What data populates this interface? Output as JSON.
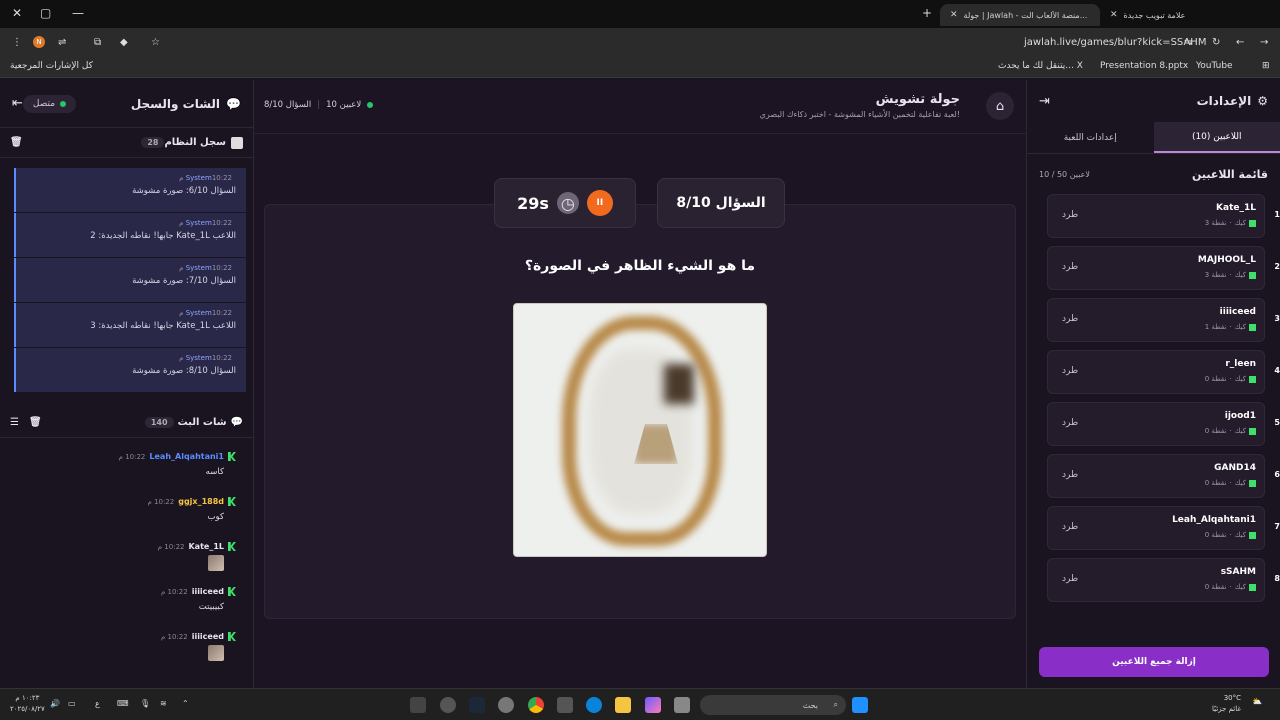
{
  "browser": {
    "tabs": [
      {
        "title": "علامة تبويب جديدة"
      },
      {
        "title": "جولة | Jawlah - منصة الألعاب الت..."
      }
    ],
    "url": "jawlah.live/games/blur?kick=SSAHM",
    "profile_initial": "N",
    "bookmarks": [
      "كل الإشارات المرجعية",
      "يتنقل لك ما يحدث... X",
      "Presentation 8.pptx",
      "YouTube"
    ]
  },
  "left_panel": {
    "title": "الشات والسجل",
    "status": "متصل",
    "system_log": {
      "title": "سجل النظام",
      "count": "28",
      "items": [
        {
          "sender": "System",
          "time": "10:22 م",
          "msg": "السؤال 6/10: صورة مشوشة"
        },
        {
          "sender": "System",
          "time": "10:22 م",
          "msg": "اللاعب Kate_1L جابها! نقاطه الجديدة: 2"
        },
        {
          "sender": "System",
          "time": "10:22 م",
          "msg": "السؤال 7/10: صورة مشوشة"
        },
        {
          "sender": "System",
          "time": "10:22 م",
          "msg": "اللاعب Kate_1L جابها! نقاطه الجديدة: 3"
        },
        {
          "sender": "System",
          "time": "10:22 م",
          "msg": "السؤال 8/10: صورة مشوشة"
        }
      ]
    },
    "stream_chat": {
      "title": "شات البث",
      "count": "140",
      "items": [
        {
          "name": "Leah_Alqahtani1",
          "time": "10:22 م",
          "text": "كاسه",
          "color": "#5b8cff"
        },
        {
          "name": "ggjx_188d",
          "time": "10:22 م",
          "text": "كوب",
          "color": "#f5c542"
        },
        {
          "name": "Kate_1L",
          "time": "10:22 م",
          "text": "",
          "color": "#ffffff"
        },
        {
          "name": "iiiiceed",
          "time": "10:22 م",
          "text": "كبيبيتت",
          "color": "#ffffff"
        },
        {
          "name": "iiiiceed",
          "time": "10:22 م",
          "text": "",
          "color": "#ffffff"
        }
      ]
    }
  },
  "center": {
    "title": "جولة تشويش",
    "subtitle": "لعبة تفاعلية لتخمين الأشياء المشوشة - اختبر ذكاءك البصري!",
    "players_online": "10 لاعبين",
    "question_progress": "السؤال 8/10",
    "question_box": "السؤال 8/10",
    "timer": "29s",
    "pause_symbol": "II",
    "question_text": "ما هو الشيء الظاهر في الصورة؟"
  },
  "right_panel": {
    "title": "الإعدادات",
    "tabs": [
      "اللاعبين (10)",
      "إعدادات اللعبة"
    ],
    "list_title": "قائمة اللاعبين",
    "list_count": "10 / 50 لاعبين",
    "kick_label": "طرد",
    "platform": "كيك",
    "players": [
      {
        "rank": "1",
        "name": "Kate_1L",
        "points": "3 نقطة"
      },
      {
        "rank": "2",
        "name": "MAJHOOL_L",
        "points": "3 نقطة"
      },
      {
        "rank": "3",
        "name": "iiiiceed",
        "points": "1 نقطة"
      },
      {
        "rank": "4",
        "name": "r_leen",
        "points": "0 نقطة"
      },
      {
        "rank": "5",
        "name": "ijood1",
        "points": "0 نقطة"
      },
      {
        "rank": "6",
        "name": "GAND14",
        "points": "0 نقطة"
      },
      {
        "rank": "7",
        "name": "Leah_Alqahtani1",
        "points": "0 نقطة"
      },
      {
        "rank": "8",
        "name": "sSAHM",
        "points": "0 نقطة"
      }
    ],
    "remove_all": "إزالة جميع اللاعبين"
  },
  "taskbar": {
    "search": "بحث",
    "weather": "30°C",
    "weather_sub": "غائم جزئيًا",
    "time": "١٠:٢٣ م",
    "date": "٢٠٢٥/٠٨/٢٧"
  },
  "colors": {
    "accent": "#8a2ec8",
    "kick_green": "#3ee06a",
    "pause": "#f26a1e"
  }
}
